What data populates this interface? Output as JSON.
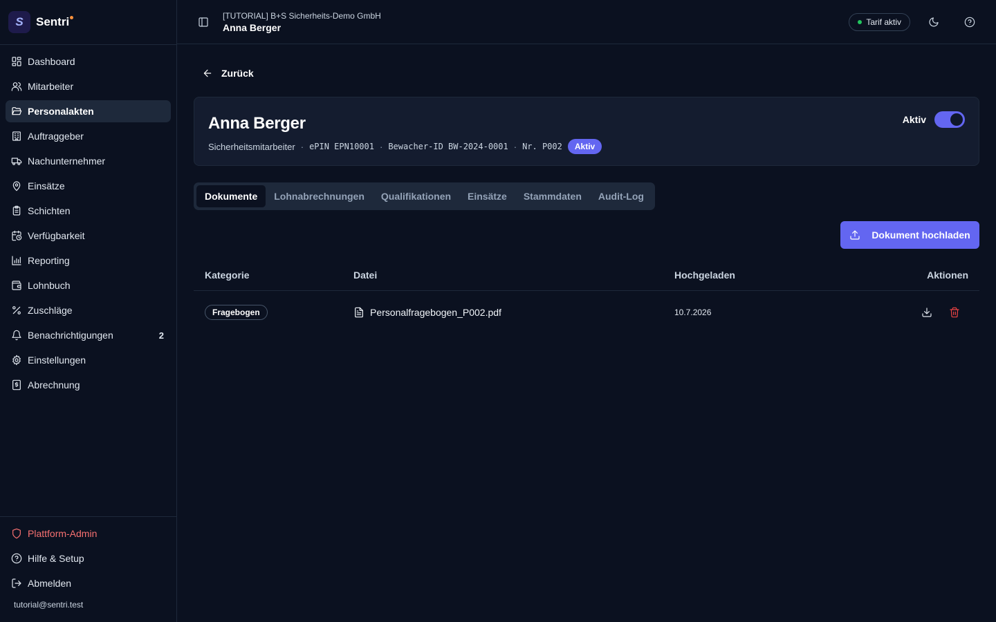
{
  "brand": {
    "logo_letter": "S",
    "name": "Sentri"
  },
  "sidebar": {
    "items": [
      {
        "label": "Dashboard",
        "icon": "dashboard-grid-icon"
      },
      {
        "label": "Mitarbeiter",
        "icon": "users-icon"
      },
      {
        "label": "Personalakten",
        "icon": "folder-open-icon",
        "active": true
      },
      {
        "label": "Auftraggeber",
        "icon": "building-icon"
      },
      {
        "label": "Nachunternehmer",
        "icon": "truck-icon"
      },
      {
        "label": "Einsätze",
        "icon": "map-pin-icon"
      },
      {
        "label": "Schichten",
        "icon": "clipboard-icon"
      },
      {
        "label": "Verfügbarkeit",
        "icon": "calendar-clock-icon"
      },
      {
        "label": "Reporting",
        "icon": "bar-chart-icon"
      },
      {
        "label": "Lohnbuch",
        "icon": "wallet-icon"
      },
      {
        "label": "Zuschläge",
        "icon": "percent-icon"
      },
      {
        "label": "Benachrichtigungen",
        "icon": "bell-icon",
        "count": "2"
      },
      {
        "label": "Einstellungen",
        "icon": "gear-icon"
      },
      {
        "label": "Abrechnung",
        "icon": "receipt-icon"
      }
    ],
    "bottom": {
      "admin": "Plattform-Admin",
      "help": "Hilfe & Setup",
      "logout": "Abmelden",
      "email": "tutorial@sentri.test"
    }
  },
  "topbar": {
    "org": "[TUTORIAL] B+S Sicherheits-Demo GmbH",
    "person": "Anna Berger",
    "tarif": "Tarif aktiv"
  },
  "main": {
    "back": "Zurück",
    "profile": {
      "name": "Anna Berger",
      "role": "Sicherheitsmitarbeiter",
      "epin": "ePIN EPN10001",
      "bewacher": "Bewacher-ID BW-2024-0001",
      "nr": "Nr. P002",
      "badge": "Aktiv",
      "toggle_label": "Aktiv",
      "active": true
    },
    "tabs": [
      "Dokumente",
      "Lohnabrechnungen",
      "Qualifikationen",
      "Einsätze",
      "Stammdaten",
      "Audit-Log"
    ],
    "upload_label": "Dokument hochladen",
    "table": {
      "headers": {
        "category": "Kategorie",
        "file": "Datei",
        "uploaded": "Hochgeladen",
        "actions": "Aktionen"
      },
      "rows": [
        {
          "category": "Fragebogen",
          "file": "Personalfragebogen_P002.pdf",
          "uploaded": "10.7.2026"
        }
      ]
    }
  },
  "colors": {
    "accent": "#6366f1",
    "danger": "#ef4444",
    "background": "#0b1120",
    "success": "#22c55e"
  }
}
